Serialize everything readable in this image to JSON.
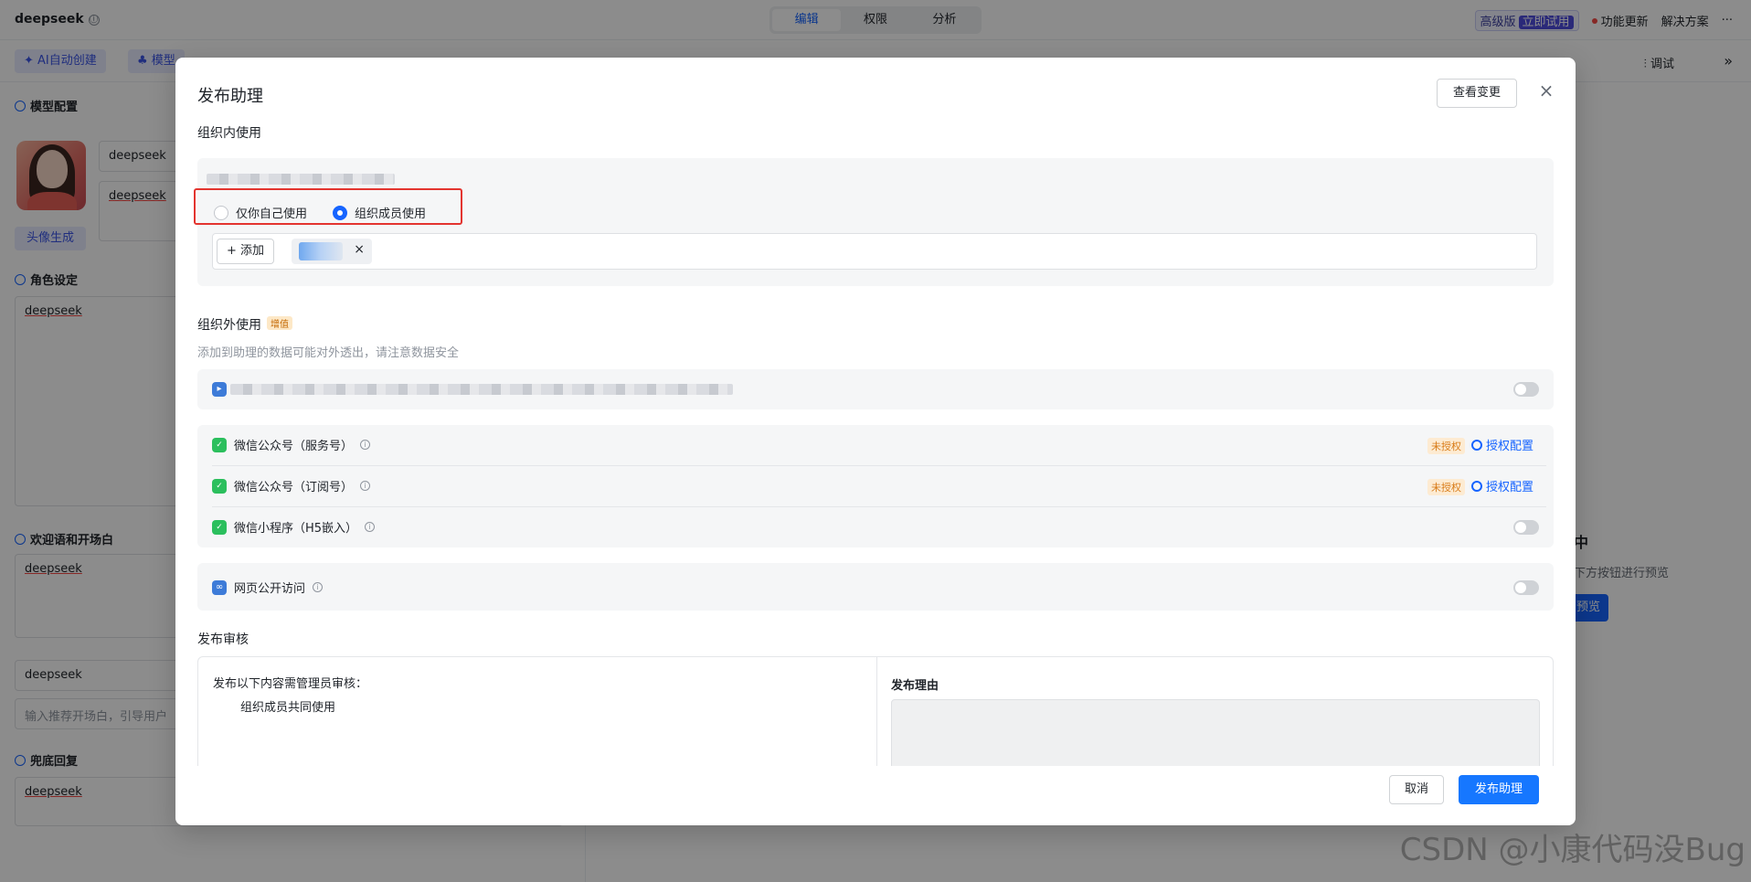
{
  "app": {
    "title": "deepseek",
    "info_icon": "ⓘ",
    "tabs": [
      {
        "label": "编辑",
        "active": true
      },
      {
        "label": "权限",
        "active": false
      },
      {
        "label": "分析",
        "active": false
      }
    ],
    "right": {
      "pro_label": "高级版",
      "pro_trial": "立即试用",
      "feature_update": "功能更新",
      "solutions": "解决方案",
      "more": "···"
    }
  },
  "toolbar": {
    "ai_create": "AI自动创建",
    "model": "模型",
    "debug": "调试",
    "collapse": "»"
  },
  "left_panel": {
    "model_config": "模型配置",
    "name_value": "deepseek",
    "desc_value": "deepseek",
    "avatar_gen": "头像生成",
    "role_setting": "角色设定",
    "role_value": "deepseek",
    "welcome": "欢迎语和开场白",
    "welcome_value": "deepseek",
    "opening_value": "deepseek",
    "opening_placeholder": "输入推荐开场白，引导用户",
    "fallback": "兜底回复",
    "fallback_value": "deepseek"
  },
  "right_panel": {
    "preview_title": "中",
    "preview_sub": "下方按钮进行预览",
    "preview_button": "预览"
  },
  "modal": {
    "title": "发布助理",
    "view_changes": "查看变更",
    "close": "×",
    "in_org": {
      "title": "组织内使用",
      "radio_self": "仅你自己使用",
      "radio_members": "组织成员使用",
      "selected": "members",
      "add_button": "+ 添加",
      "tag_close": "×"
    },
    "out_org": {
      "title": "组织外使用",
      "badge": "增值",
      "note": "添加到助理的数据可能对外透出，请注意数据安全",
      "channels": [
        {
          "label": "微信公众号（服务号）",
          "status": "未授权",
          "action": "授权配置"
        },
        {
          "label": "微信公众号（订阅号）",
          "status": "未授权",
          "action": "授权配置"
        },
        {
          "label": "微信小程序（H5嵌入）",
          "toggle": false
        }
      ],
      "web": {
        "label": "网页公开访问",
        "toggle": false
      }
    },
    "review": {
      "title": "发布审核",
      "left_label": "发布以下内容需管理员审核：",
      "item": "组织成员共同使用",
      "reason_label": "发布理由"
    },
    "cancel": "取消",
    "publish": "发布助理"
  },
  "watermark": "CSDN @小康代码没Bug"
}
